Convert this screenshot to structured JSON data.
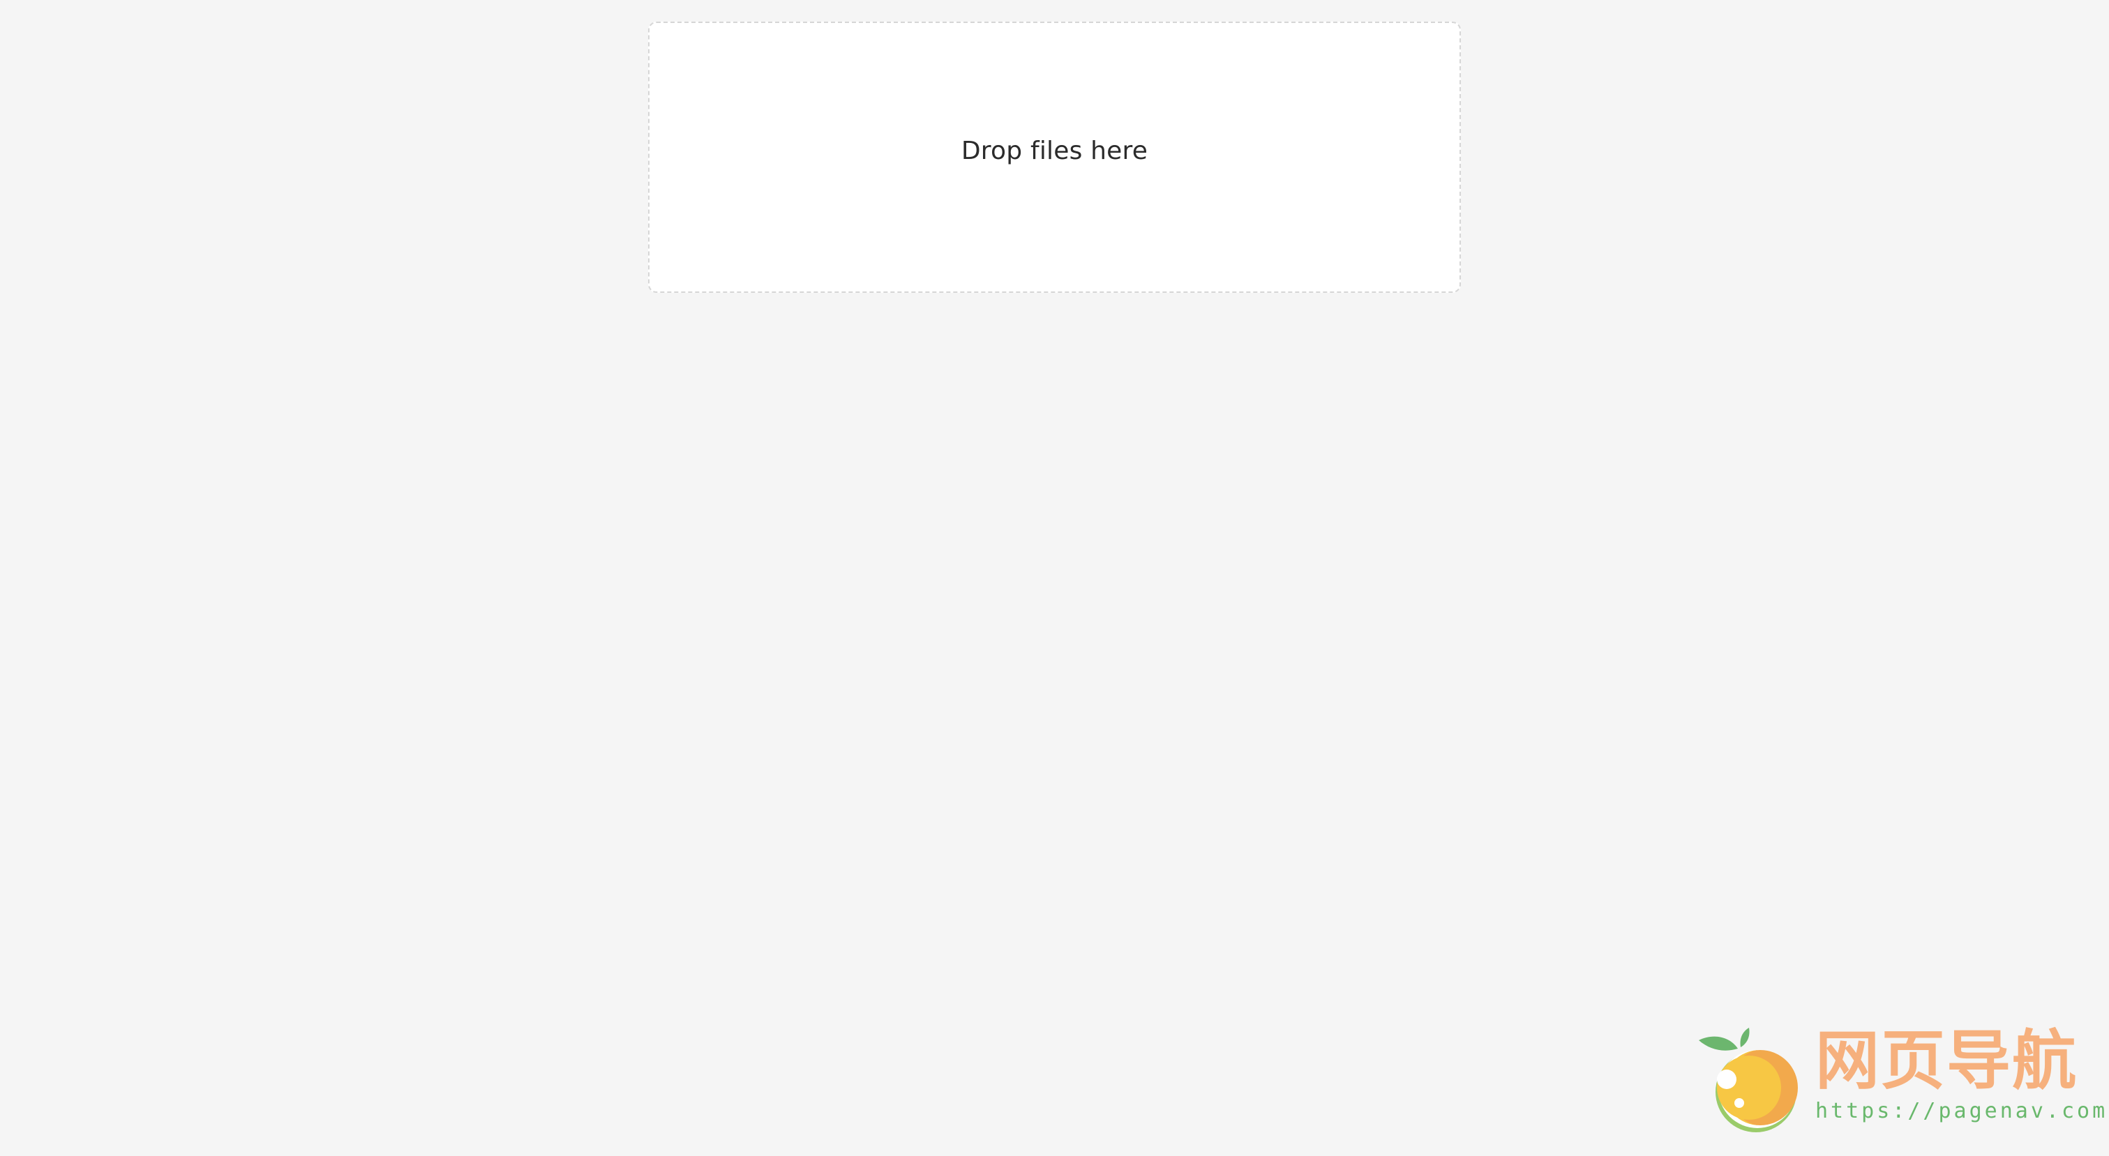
{
  "dropzone": {
    "label": "Drop files here"
  },
  "watermark": {
    "title": "网页导航",
    "url": "https://pagenav.com",
    "logo_icon": "orange-fruit-icon",
    "colors": {
      "title": "#f6b07d",
      "url": "#69b86c",
      "fruit": "#f7c744",
      "leaf": "#6cb66e"
    }
  }
}
